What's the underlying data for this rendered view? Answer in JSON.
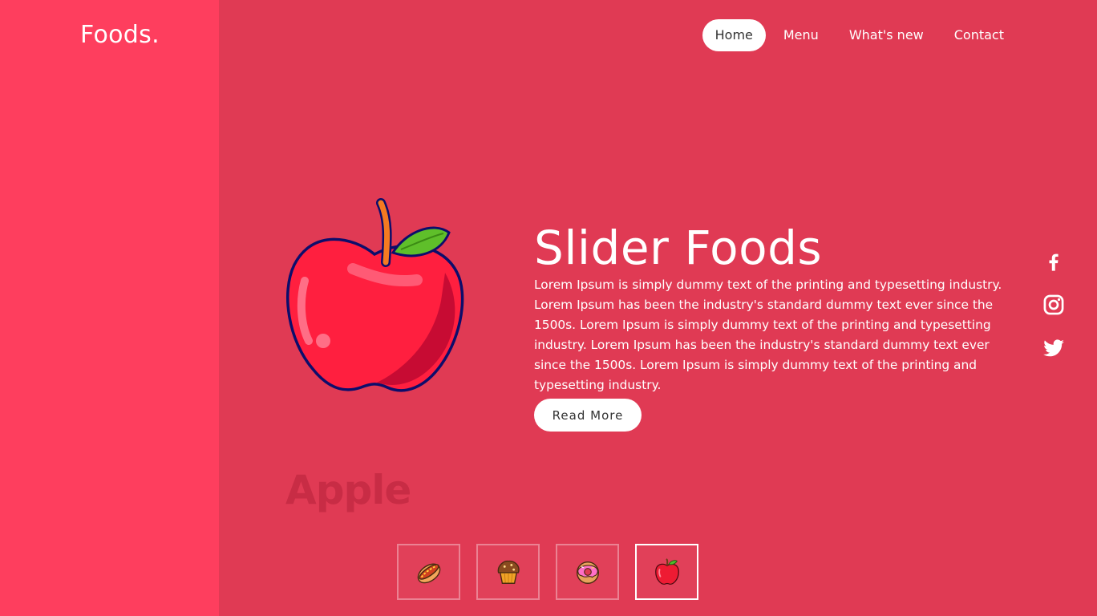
{
  "brand": {
    "logo": "Foods."
  },
  "nav": {
    "items": [
      "Home",
      "Menu",
      "What's new",
      "Contact"
    ],
    "active": "Home"
  },
  "hero": {
    "title": "Slider Foods",
    "description": "Lorem Ipsum is simply dummy text of the printing and typesetting industry. Lorem Ipsum has been the industry's standard dummy text ever since the 1500s. Lorem Ipsum is simply dummy text of the printing and typesetting industry. Lorem Ipsum has been the industry's standard dummy text ever since the 1500s. Lorem Ipsum is simply dummy text of the printing and typesetting industry.",
    "button_label": "Read More",
    "item_name": "Apple",
    "image_icon": "apple-icon"
  },
  "social": [
    "facebook-icon",
    "instagram-icon",
    "twitter-icon"
  ],
  "thumbnails": [
    {
      "icon": "hotdog-icon",
      "active": false
    },
    {
      "icon": "muffin-icon",
      "active": false
    },
    {
      "icon": "donut-icon",
      "active": false
    },
    {
      "icon": "apple-icon",
      "active": true
    }
  ],
  "colors": {
    "background": "#e03a54",
    "left_panel": "#fe3e5e",
    "text": "#ffffff",
    "item_name": "#c82c45"
  }
}
